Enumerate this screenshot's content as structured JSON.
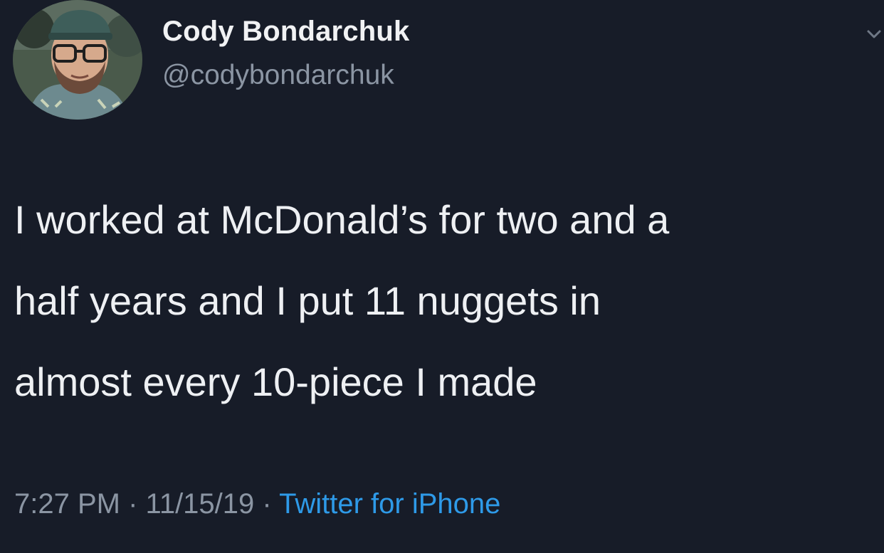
{
  "user": {
    "display_name": "Cody Bondarchuk",
    "handle": "@codybondarchuk",
    "avatar_icon": "profile-photo"
  },
  "tweet": {
    "lines": [
      "I worked at McDonald’s for two and a",
      "half years and I put 11 nuggets in",
      "almost every 10-piece I made"
    ]
  },
  "meta": {
    "time": "7:27 PM",
    "separator": "·",
    "date": "11/15/19",
    "source": "Twitter for iPhone"
  },
  "menu": {
    "icon": "chevron-down-icon"
  },
  "colors": {
    "background": "#171c28",
    "text": "#eef0f3",
    "muted": "#8b95a3",
    "link": "#2e9ae8"
  }
}
